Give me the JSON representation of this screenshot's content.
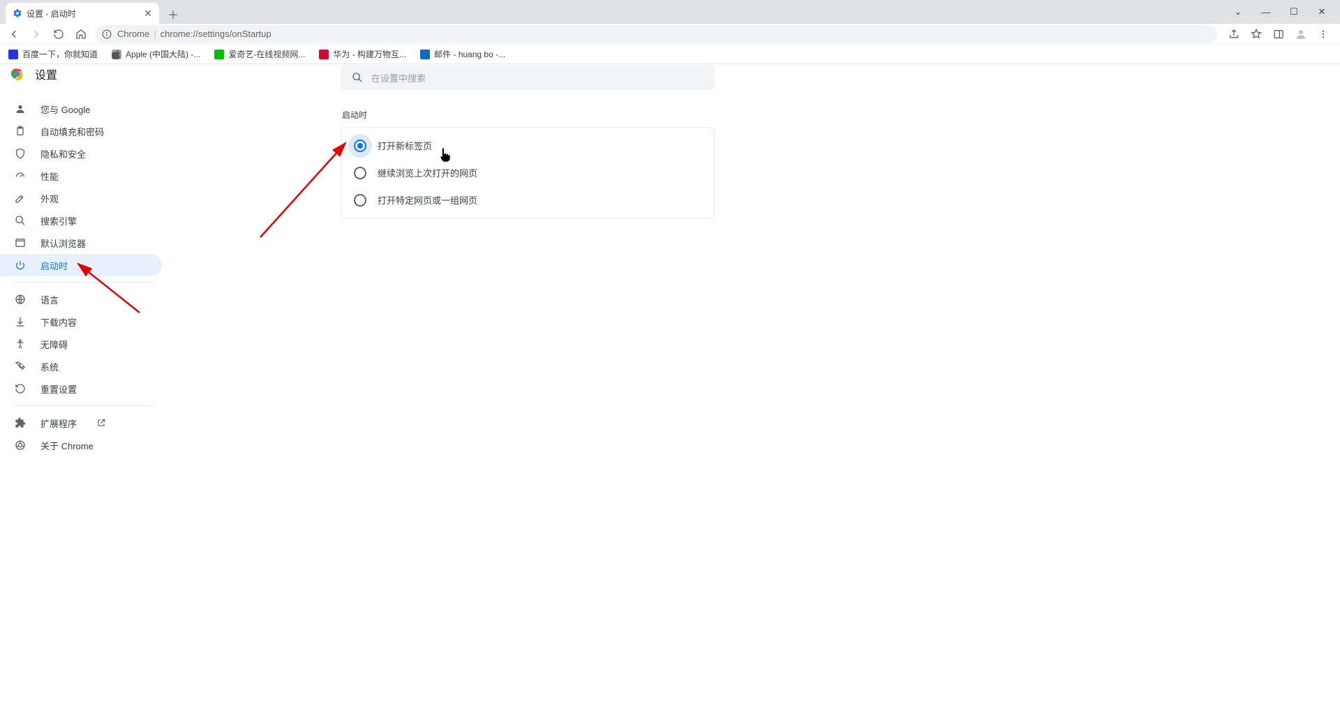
{
  "window": {
    "tab_title": "设置 - 启动时",
    "controls": {
      "chevron": "⌄",
      "min": "—",
      "max": "☐",
      "close": "✕"
    }
  },
  "toolbar": {
    "url_prefix": "Chrome",
    "url_path": "chrome://settings/onStartup"
  },
  "bookmarks": [
    {
      "label": "百度一下，你就知道",
      "color": "#2932e1"
    },
    {
      "label": "Apple (中国大陆) -...",
      "color": "#9e9e9e"
    },
    {
      "label": "爱奇艺-在线视频网...",
      "color": "#00be06"
    },
    {
      "label": "华为 - 构建万物互...",
      "color": "#cf0a2c"
    },
    {
      "label": "邮件 - huang bo -...",
      "color": "#0f6cbd"
    }
  ],
  "settings": {
    "title": "设置",
    "search_placeholder": "在设置中搜索"
  },
  "sidebar": {
    "items": [
      {
        "label": "您与 Google"
      },
      {
        "label": "自动填充和密码"
      },
      {
        "label": "隐私和安全"
      },
      {
        "label": "性能"
      },
      {
        "label": "外观"
      },
      {
        "label": "搜索引擎"
      },
      {
        "label": "默认浏览器"
      },
      {
        "label": "启动时"
      }
    ],
    "items2": [
      {
        "label": "语言"
      },
      {
        "label": "下载内容"
      },
      {
        "label": "无障碍"
      },
      {
        "label": "系统"
      },
      {
        "label": "重置设置"
      }
    ],
    "items3": [
      {
        "label": "扩展程序"
      },
      {
        "label": "关于 Chrome"
      }
    ]
  },
  "main": {
    "section_title": "启动时",
    "options": [
      {
        "label": "打开新标签页"
      },
      {
        "label": "继续浏览上次打开的网页"
      },
      {
        "label": "打开特定网页或一组网页"
      }
    ]
  }
}
